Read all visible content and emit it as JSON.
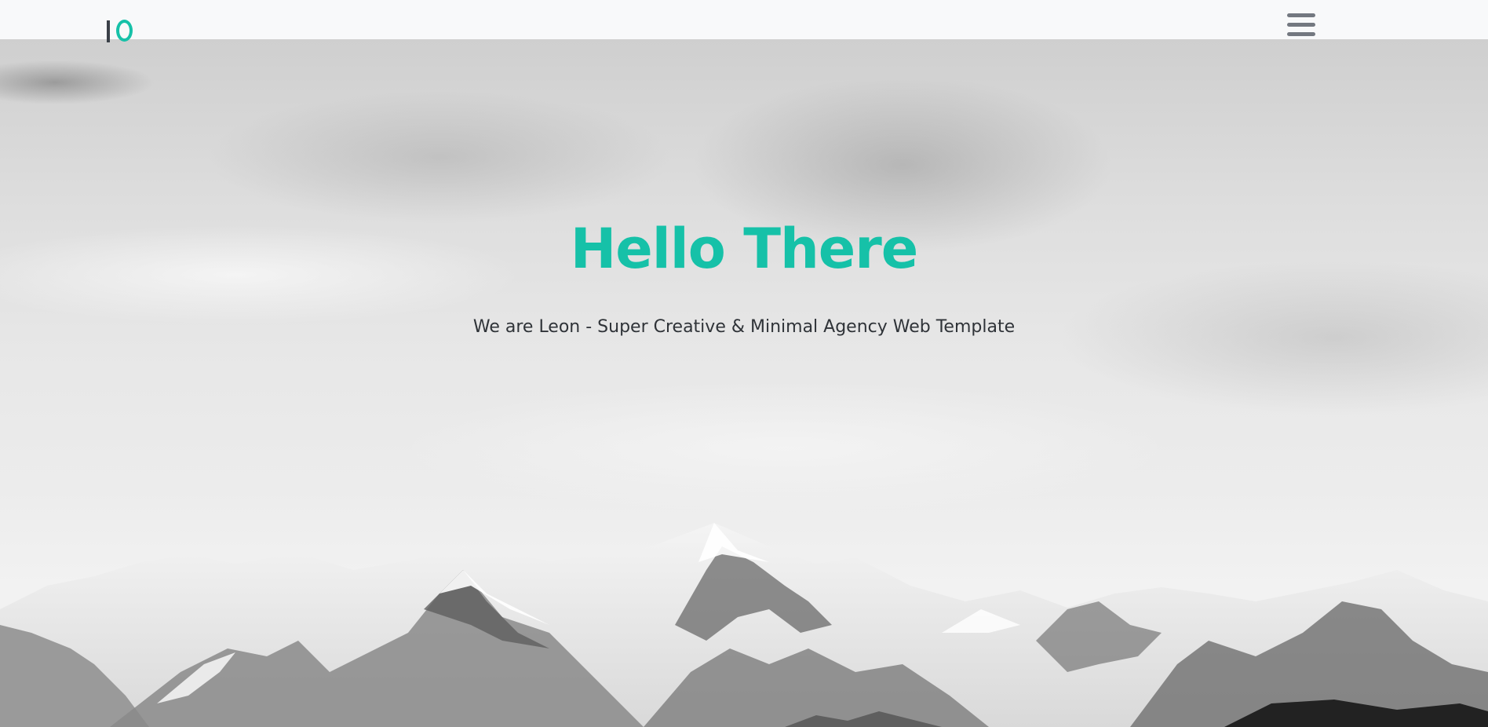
{
  "navbar": {
    "logo": {
      "name": "logo-mark",
      "ring_color": "#16c1a8",
      "bar_color": "#3a4048"
    },
    "menu_icon": "hamburger-menu-icon"
  },
  "hero": {
    "title": "Hello There",
    "subtitle": "We are Leon - Super Creative & Minimal Agency Web Template",
    "title_color": "#16c1a8",
    "background": "grayscale snowy mountain range under cloudy sky"
  }
}
